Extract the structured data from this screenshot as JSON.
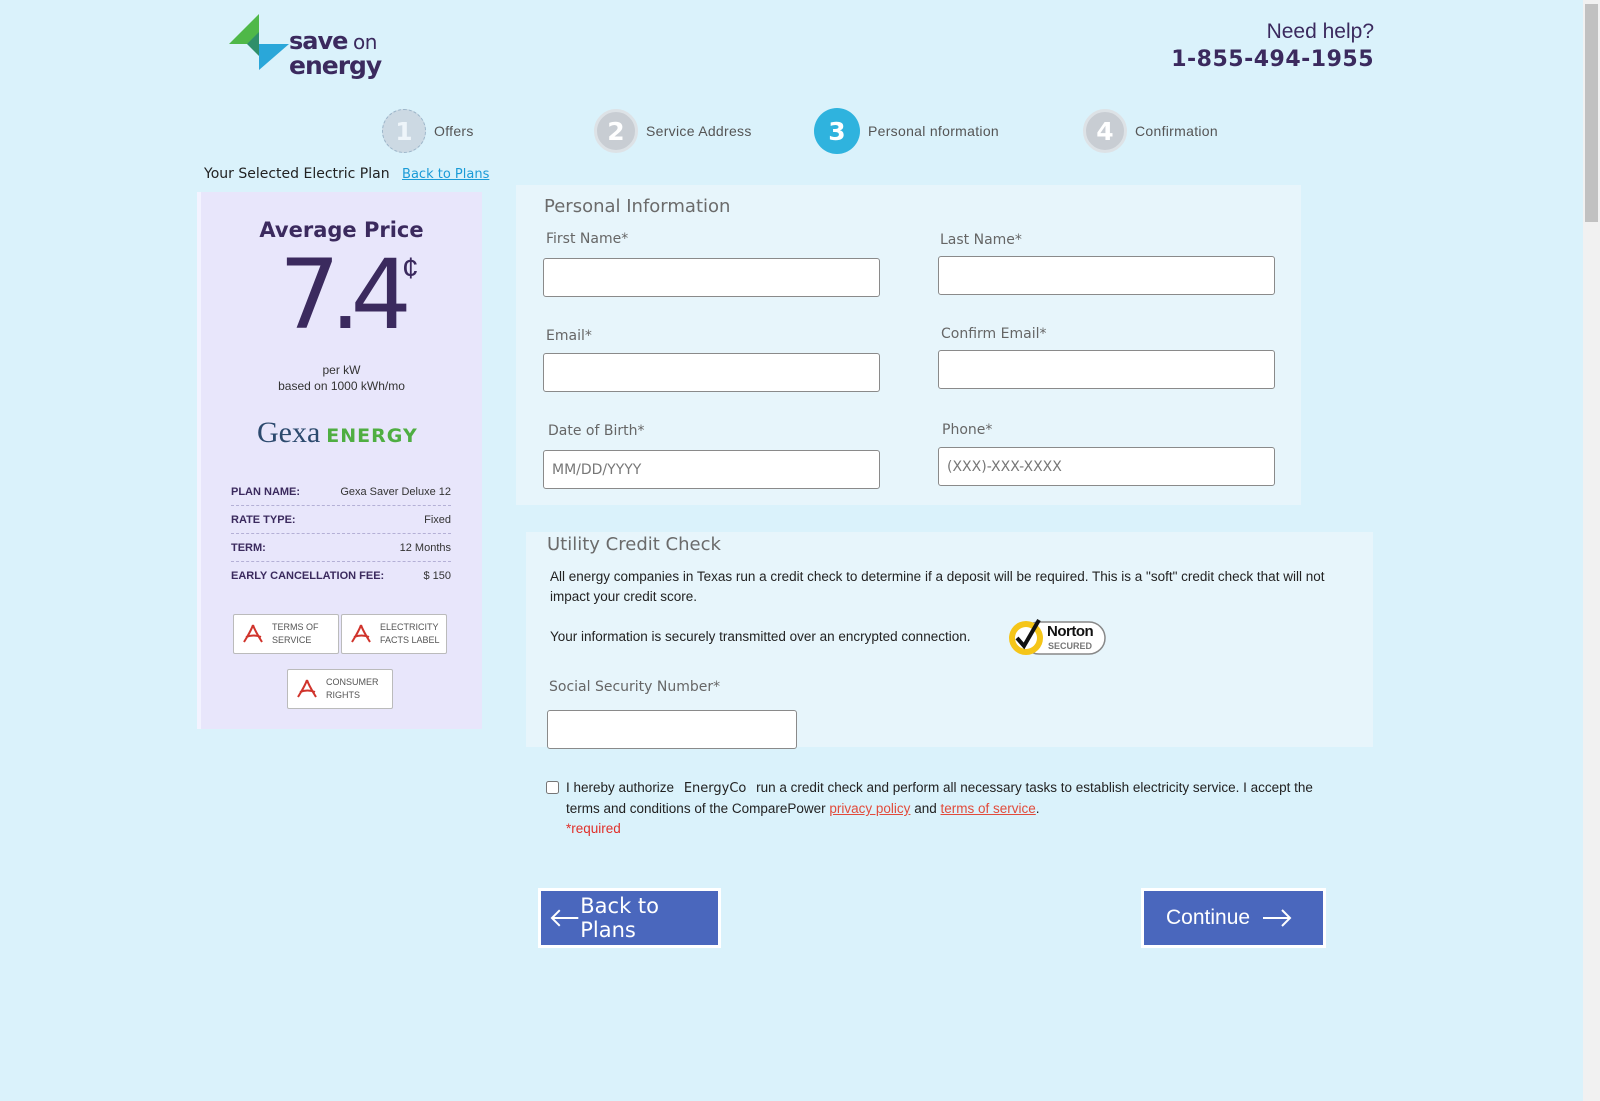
{
  "header": {
    "logo_save": "save",
    "logo_on": "on",
    "logo_energy": "energy",
    "help_title": "Need help?",
    "help_phone": "1-855-494-1955"
  },
  "steps": [
    {
      "number": "1",
      "label": "Offers"
    },
    {
      "number": "2",
      "label": "Service Address"
    },
    {
      "number": "3",
      "label": "Personal  nformation"
    },
    {
      "number": "4",
      "label": "Confirmation"
    }
  ],
  "plan": {
    "header": "Your Selected Electric Plan",
    "back_link": "Back to Plans",
    "avg_title": "Average Price",
    "price": "7.4",
    "cent": "¢",
    "per": "per kW",
    "basis": "based on 1000 kWh/mo",
    "provider_a": "Gexa",
    "provider_b": "ENERGY",
    "rows": [
      {
        "key": "PLAN NAME:",
        "value": "Gexa Saver Deluxe 12"
      },
      {
        "key": "RATE TYPE:",
        "value": "Fixed"
      },
      {
        "key": "TERM:",
        "value": "12 Months"
      },
      {
        "key": "EARLY CANCELLATION FEE:",
        "value": "$ 150"
      }
    ],
    "docs": [
      "TERMS OF SERVICE",
      "ELECTRICITY FACTS LABEL",
      "CONSUMER RIGHTS"
    ]
  },
  "personal": {
    "title": "Personal Information",
    "first_name": {
      "label": "First Name*",
      "value": ""
    },
    "last_name": {
      "label": "Last Name*",
      "value": ""
    },
    "email": {
      "label": "Email*",
      "value": ""
    },
    "confirm_email": {
      "label": "Confirm Email*",
      "value": ""
    },
    "dob": {
      "label": "Date of Birth*",
      "placeholder": "MM/DD/YYYY"
    },
    "phone": {
      "label": "Phone*",
      "placeholder": "(XXX)-XXX-XXXX"
    }
  },
  "credit": {
    "title": "Utility Credit Check",
    "text1": "All energy companies in Texas run a credit check to determine if a deposit will be required. This is a \"soft\" credit check that will not impact your credit score.",
    "text2": "Your information is securely transmitted over an encrypted connection.",
    "norton_a": "Norton",
    "norton_b": "SECURED",
    "ssn_label": "Social Security Number*"
  },
  "auth": {
    "prefix": "I hereby authorize",
    "company": "EnergyCo",
    "middle": "run a credit check and perform all necessary tasks to establish electricity service. I accept the terms and conditions of the ComparePower",
    "privacy": "privacy policy",
    "and": "and",
    "terms": "terms of service",
    "end": ".",
    "required": "*required"
  },
  "buttons": {
    "back": "Back to Plans",
    "continue": "Continue"
  },
  "colors": {
    "accent": "#2fb3de",
    "button": "#4a67bd",
    "brand": "#3b2a5e",
    "link_red": "#e24b3b"
  }
}
